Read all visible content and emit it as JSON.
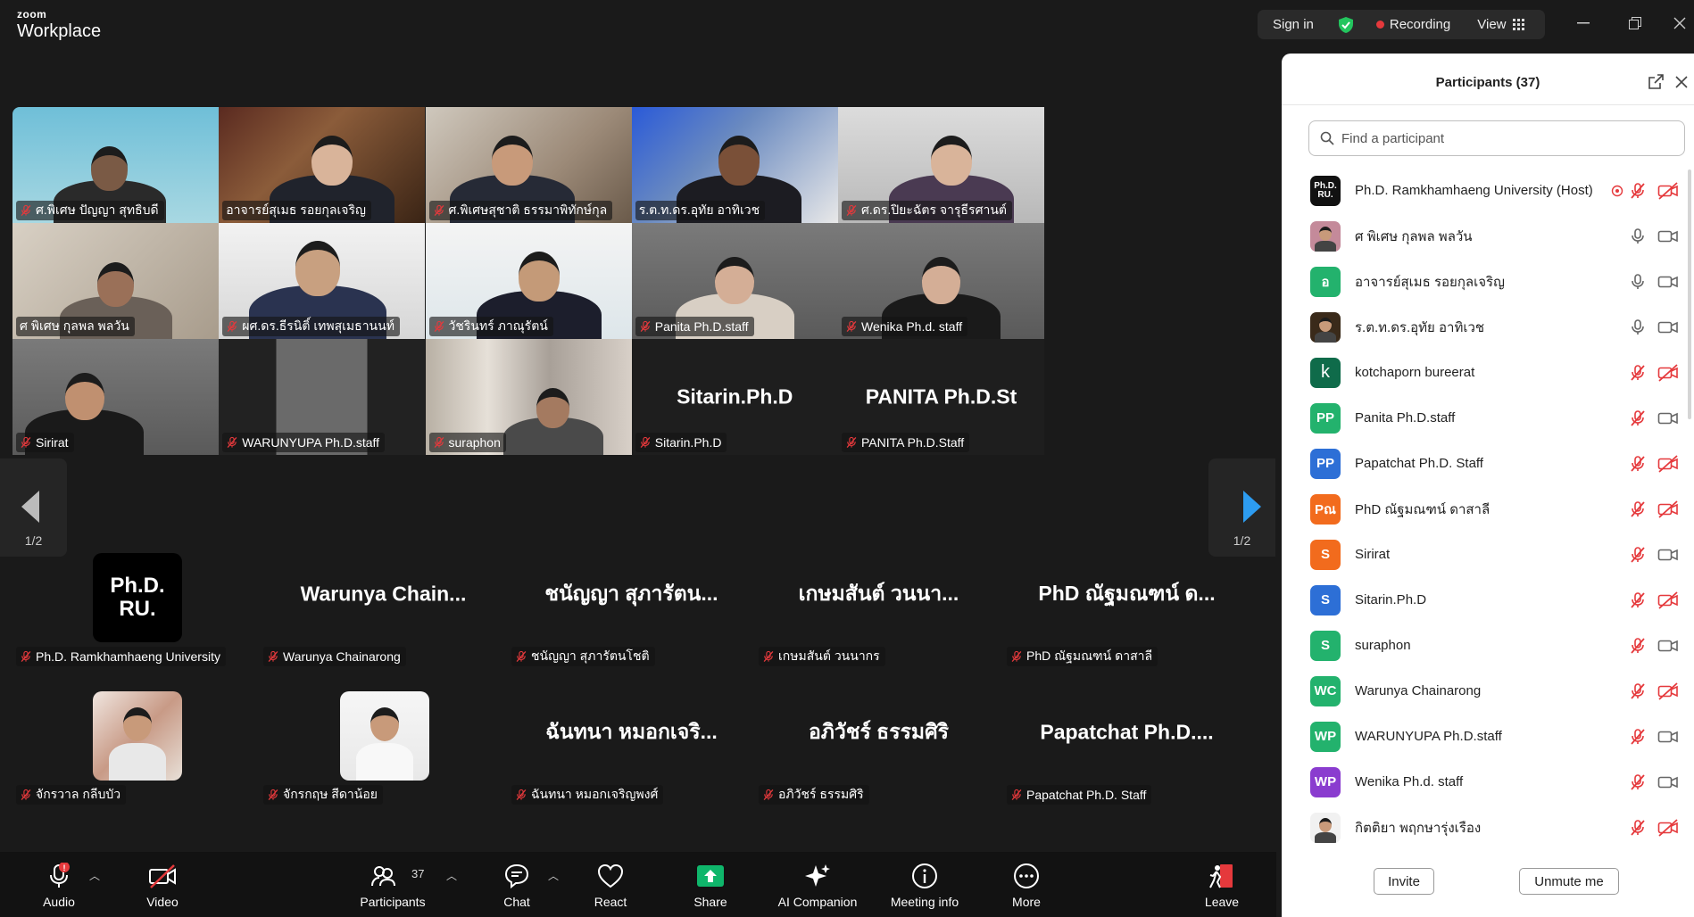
{
  "app": {
    "brand_top": "zoom",
    "brand_bottom": "Workplace"
  },
  "titlebar": {
    "sign_in": "Sign in",
    "recording": "Recording",
    "view": "View"
  },
  "gallery": {
    "page_indicator": "1/2",
    "video_tiles": [
      {
        "name": "ศ.พิเศษ ปัญญา สุทธิบดี",
        "muted": true
      },
      {
        "name": "อาจารย์สุเมธ  รอยกุลเจริญ",
        "muted": false,
        "active_speaker": true
      },
      {
        "name": "ศ.พิเศษสุชาติ  ธรรมาพิทักษ์กุล",
        "muted": true
      },
      {
        "name": "ร.ต.ท.ดร.อุทัย  อาทิเวช",
        "muted": false
      },
      {
        "name": "ศ.ดร.ปิยะฉัตร จารุธีรศานต์",
        "muted": true
      },
      {
        "name": "ศ พิเศษ กุลพล พลวัน",
        "muted": false
      },
      {
        "name": "ผศ.ดร.ธีรนิติ์  เทพสุเมธานนท์",
        "muted": true
      },
      {
        "name": "วัชรินทร์ ภาณุรัตน์",
        "muted": true
      },
      {
        "name": "Panita Ph.D.staff",
        "muted": true
      },
      {
        "name": "Wenika Ph.d. staff",
        "muted": true
      },
      {
        "name": "Sirirat",
        "muted": true
      },
      {
        "name": "WARUNYUPA Ph.D.staff",
        "muted": true
      },
      {
        "name": "suraphon",
        "muted": true
      },
      {
        "name": "Sitarin.Ph.D",
        "muted": true,
        "big_name": "Sitarin.Ph.D"
      },
      {
        "name": "PANITA Ph.D.Staff",
        "muted": true,
        "big_name": "PANITA  Ph.D.St"
      }
    ],
    "audio_tiles": [
      {
        "name": "Ph.D. Ramkhamhaeng University",
        "big_name": "",
        "logo": "Ph.D.\nRU."
      },
      {
        "name": "Warunya Chainarong",
        "big_name": "Warunya  Chain..."
      },
      {
        "name": "ชนัญญา สุภารัตนโชติ",
        "big_name": "ชนัญญา สุภารัตน..."
      },
      {
        "name": "เกษมสันต์ วนนากร",
        "big_name": "เกษมสันต์ วนนา..."
      },
      {
        "name": "PhD ณัฐมณฑน์ ดาสาลี",
        "big_name": "PhD ณัฐมณฑน์ ด..."
      },
      {
        "name": "จักรวาล กลีบบัว",
        "big_name": "",
        "photo": true
      },
      {
        "name": "จักรกฤษ สีดาน้อย",
        "big_name": "",
        "photo": true
      },
      {
        "name": "ฉันทนา หมอกเจริญพงศ์",
        "big_name": "ฉันทนา หมอกเจริ..."
      },
      {
        "name": "อภิวัชร์ ธรรมศิริ",
        "big_name": "อภิวัชร์ ธรรมศิริ"
      },
      {
        "name": "Papatchat Ph.D. Staff",
        "big_name": "Papatchat  Ph.D...."
      }
    ]
  },
  "toolbar": {
    "audio": "Audio",
    "audio_badge": "!",
    "video": "Video",
    "participants": "Participants",
    "participants_count": "37",
    "chat": "Chat",
    "react": "React",
    "share": "Share",
    "ai_companion": "AI Companion",
    "meeting_info": "Meeting info",
    "more": "More",
    "leave": "Leave"
  },
  "panel": {
    "title": "Participants (37)",
    "search_placeholder": "Find a participant",
    "participants": [
      {
        "name": "Ph.D. Ramkhamhaeng University (Host)",
        "initials": "Ph.D.\nRU.",
        "color": "#111111",
        "mic": "muted",
        "cam": "off",
        "host": true
      },
      {
        "name": "ศ พิเศษ กุลพล พลวัน",
        "initials": "",
        "color": "#c48a9a",
        "mic": "on",
        "cam": "on",
        "photo": true
      },
      {
        "name": "อาจารย์สุเมธ  รอยกุลเจริญ",
        "initials": "อ",
        "color": "#23b26d",
        "mic": "on",
        "cam": "on"
      },
      {
        "name": "ร.ต.ท.ดร.อุทัย  อาทิเวช",
        "initials": "",
        "color": "#3a2a1a",
        "mic": "on",
        "cam": "on",
        "photo": true
      },
      {
        "name": "kotchaporn bureerat",
        "initials": "k",
        "color": "#0f6b4a",
        "mic": "muted",
        "cam": "off"
      },
      {
        "name": "Panita Ph.D.staff",
        "initials": "PP",
        "color": "#23b26d",
        "mic": "muted",
        "cam": "on"
      },
      {
        "name": "Papatchat Ph.D. Staff",
        "initials": "PP",
        "color": "#2d6fd6",
        "mic": "muted",
        "cam": "off"
      },
      {
        "name": "PhD ณัฐมณฑน์ ดาสาลี",
        "initials": "Pณ",
        "color": "#f26b1d",
        "mic": "muted",
        "cam": "off"
      },
      {
        "name": "Sirirat",
        "initials": "S",
        "color": "#f26b1d",
        "mic": "muted",
        "cam": "on"
      },
      {
        "name": "Sitarin.Ph.D",
        "initials": "S",
        "color": "#2d6fd6",
        "mic": "muted",
        "cam": "off"
      },
      {
        "name": "suraphon",
        "initials": "S",
        "color": "#23b26d",
        "mic": "muted",
        "cam": "on"
      },
      {
        "name": "Warunya Chainarong",
        "initials": "WC",
        "color": "#23b26d",
        "mic": "muted",
        "cam": "off"
      },
      {
        "name": "WARUNYUPA Ph.D.staff",
        "initials": "WP",
        "color": "#23b26d",
        "mic": "muted",
        "cam": "on"
      },
      {
        "name": "Wenika Ph.d. staff",
        "initials": "WP",
        "color": "#8a3ccf",
        "mic": "muted",
        "cam": "on"
      },
      {
        "name": "กิตติยา พฤกษารุ่งเรือง",
        "initials": "",
        "color": "#f1f1f1",
        "mic": "muted",
        "cam": "off",
        "photo": true
      }
    ],
    "invite": "Invite",
    "unmute_me": "Unmute me"
  },
  "colors": {
    "accent_green": "#23d18b",
    "muted_red": "#e5393c",
    "share_green": "#0fb66b",
    "arrow_blue": "#2d9cf0"
  }
}
